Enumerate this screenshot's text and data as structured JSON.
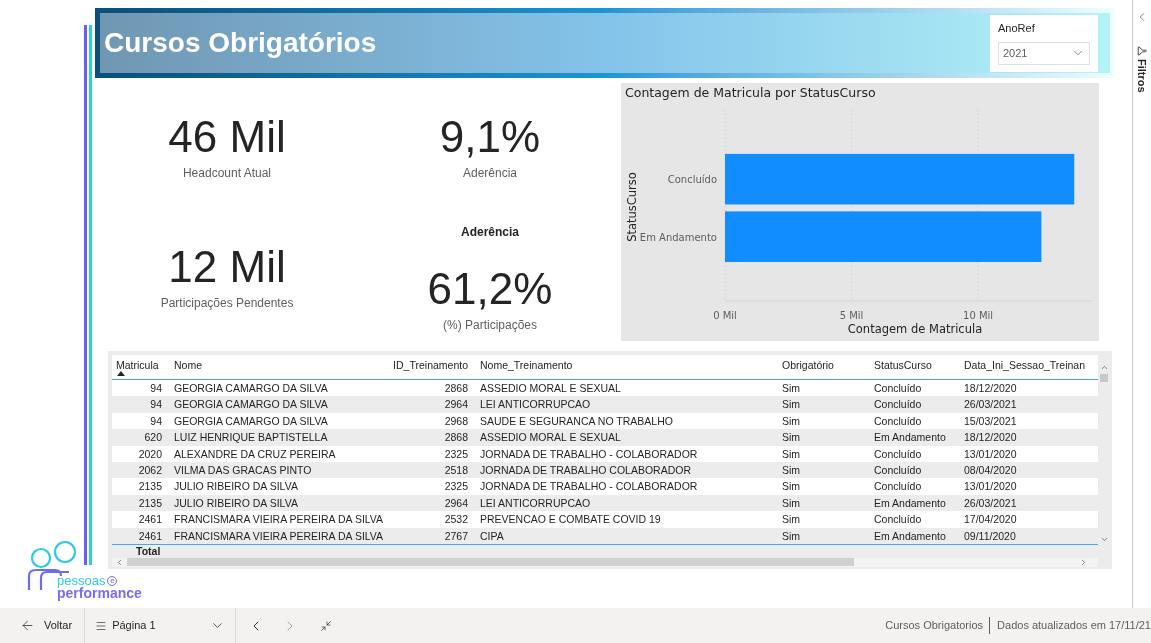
{
  "header": {
    "title": "Cursos Obrigatórios"
  },
  "slicer": {
    "label": "AnoRef",
    "value": "2021"
  },
  "kpis": [
    {
      "value": "46 Mil",
      "label": "Headcount Atual"
    },
    {
      "value": "12 Mil",
      "label": "Participações Pendentes"
    },
    {
      "value": "9,1%",
      "label": "Aderência"
    },
    {
      "title": "Aderência",
      "value": "61,2%",
      "label": "(%) Participações"
    }
  ],
  "chart": {
    "chart_data": {
      "type": "bar",
      "orientation": "horizontal",
      "title": "Contagem de Matricula por StatusCurso",
      "xlabel": "Contagem de Matricula",
      "ylabel": "StatusCurso",
      "categories": [
        "Concluído",
        "Em Andamento"
      ],
      "series": [
        {
          "color": "#118dff",
          "values": [
            13.8,
            12.5
          ]
        }
      ],
      "xlim": [
        0,
        14.5
      ],
      "xticks": [
        {
          "value": 0,
          "label": "0 Mil"
        },
        {
          "value": 5,
          "label": "5 Mil"
        },
        {
          "value": 10,
          "label": "10 Mil"
        }
      ]
    }
  },
  "table": {
    "columns": [
      {
        "label": "Matricula",
        "kind": "number",
        "sorted": true
      },
      {
        "label": "Nome",
        "kind": "text",
        "sorted": false
      },
      {
        "label": "ID_Treinamento",
        "kind": "number",
        "sorted": false
      },
      {
        "label": "Nome_Treinamento",
        "kind": "text",
        "sorted": false
      },
      {
        "label": "Obrigatório",
        "kind": "text",
        "sorted": false
      },
      {
        "label": "StatusCurso",
        "kind": "text",
        "sorted": false
      },
      {
        "label": "Data_Ini_Sessao_Treinan",
        "kind": "text",
        "sorted": false
      }
    ],
    "rows": [
      [
        "94",
        "GEORGIA CAMARGO DA SILVA",
        "2868",
        "ASSEDIO MORAL E SEXUAL",
        "Sim",
        "Concluído",
        "18/12/2020"
      ],
      [
        "94",
        "GEORGIA CAMARGO DA SILVA",
        "2964",
        "LEI ANTICORRUPCAO",
        "Sim",
        "Concluído",
        "26/03/2021"
      ],
      [
        "94",
        "GEORGIA CAMARGO DA SILVA",
        "2968",
        "SAUDE E SEGURANCA NO TRABALHO",
        "Sim",
        "Concluído",
        "15/03/2021"
      ],
      [
        "620",
        "LUIZ HENRIQUE BAPTISTELLA",
        "2868",
        "ASSEDIO MORAL E SEXUAL",
        "Sim",
        "Em Andamento",
        "18/12/2020"
      ],
      [
        "2020",
        "ALEXANDRE DA CRUZ PEREIRA",
        "2325",
        "JORNADA DE TRABALHO - COLABORADOR",
        "Sim",
        "Concluído",
        "13/01/2020"
      ],
      [
        "2062",
        "VILMA DAS GRACAS PINTO",
        "2518",
        "JORNADA DE TRABALHO COLABORADOR",
        "Sim",
        "Concluído",
        "08/04/2020"
      ],
      [
        "2135",
        "JULIO RIBEIRO DA SILVA",
        "2325",
        "JORNADA DE TRABALHO - COLABORADOR",
        "Sim",
        "Concluído",
        "13/01/2020"
      ],
      [
        "2135",
        "JULIO RIBEIRO DA SILVA",
        "2964",
        "LEI ANTICORRUPCAO",
        "Sim",
        "Em Andamento",
        "26/03/2021"
      ],
      [
        "2461",
        "FRANCISMARA VIEIRA PEREIRA DA SILVA",
        "2532",
        "PREVENCAO E COMBATE COVID 19",
        "Sim",
        "Concluído",
        "17/04/2020"
      ],
      [
        "2461",
        "FRANCISMARA VIEIRA PEREIRA DA SILVA",
        "2767",
        "CIPA",
        "Sim",
        "Em Andamento",
        "09/11/2020"
      ]
    ],
    "total_label": "Total"
  },
  "logo": {
    "word1": "pessoas",
    "mark": "e",
    "word2": "performance"
  },
  "filters_pane": {
    "label": "Filtros"
  },
  "footer": {
    "back": "Voltar",
    "page": "Página 1",
    "report": "Cursos Obrigatorios",
    "updated": "Dados atualizados em 17/11/21"
  }
}
